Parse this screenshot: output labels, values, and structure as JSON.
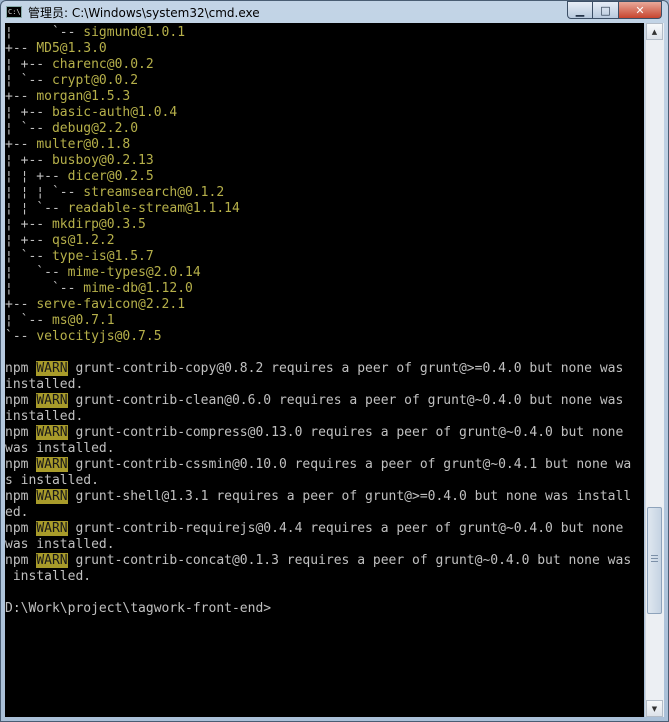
{
  "window": {
    "title": "管理员: C:\\Windows\\system32\\cmd.exe",
    "icon_text": "C:\\"
  },
  "caption": {
    "minimize": "▁",
    "maximize": "□",
    "close": "✕"
  },
  "console": {
    "lines": [
      {
        "prefix": "¦     `-- ",
        "pkg": "sigmund@1.0.1"
      },
      {
        "prefix": "+-- ",
        "pkg": "MD5@1.3.0"
      },
      {
        "prefix": "¦ +-- ",
        "pkg": "charenc@0.0.2"
      },
      {
        "prefix": "¦ `-- ",
        "pkg": "crypt@0.0.2"
      },
      {
        "prefix": "+-- ",
        "pkg": "morgan@1.5.3"
      },
      {
        "prefix": "¦ +-- ",
        "pkg": "basic-auth@1.0.4"
      },
      {
        "prefix": "¦ `-- ",
        "pkg": "debug@2.2.0"
      },
      {
        "prefix": "+-- ",
        "pkg": "multer@0.1.8"
      },
      {
        "prefix": "¦ +-- ",
        "pkg": "busboy@0.2.13"
      },
      {
        "prefix": "¦ ¦ +-- ",
        "pkg": "dicer@0.2.5"
      },
      {
        "prefix": "¦ ¦ ¦ `-- ",
        "pkg": "streamsearch@0.1.2"
      },
      {
        "prefix": "¦ ¦ `-- ",
        "pkg": "readable-stream@1.1.14"
      },
      {
        "prefix": "¦ +-- ",
        "pkg": "mkdirp@0.3.5"
      },
      {
        "prefix": "¦ +-- ",
        "pkg": "qs@1.2.2"
      },
      {
        "prefix": "¦ `-- ",
        "pkg": "type-is@1.5.7"
      },
      {
        "prefix": "¦   `-- ",
        "pkg": "mime-types@2.0.14"
      },
      {
        "prefix": "¦     `-- ",
        "pkg": "mime-db@1.12.0"
      },
      {
        "prefix": "+-- ",
        "pkg": "serve-favicon@2.2.1"
      },
      {
        "prefix": "¦ `-- ",
        "pkg": "ms@0.7.1"
      },
      {
        "prefix": "`-- ",
        "pkg": "velocityjs@0.7.5"
      },
      {
        "text": ""
      },
      {
        "npm": "npm",
        "warn": "WARN",
        "text": " grunt-contrib-copy@0.8.2 requires a peer of grunt@>=0.4.0 but none was"
      },
      {
        "text": "installed."
      },
      {
        "npm": "npm",
        "warn": "WARN",
        "text": " grunt-contrib-clean@0.6.0 requires a peer of grunt@~0.4.0 but none was"
      },
      {
        "text": "installed."
      },
      {
        "npm": "npm",
        "warn": "WARN",
        "text": " grunt-contrib-compress@0.13.0 requires a peer of grunt@~0.4.0 but none"
      },
      {
        "text": "was installed."
      },
      {
        "npm": "npm",
        "warn": "WARN",
        "text": " grunt-contrib-cssmin@0.10.0 requires a peer of grunt@~0.4.1 but none wa"
      },
      {
        "text": "s installed."
      },
      {
        "npm": "npm",
        "warn": "WARN",
        "text": " grunt-shell@1.3.1 requires a peer of grunt@>=0.4.0 but none was install"
      },
      {
        "text": "ed."
      },
      {
        "npm": "npm",
        "warn": "WARN",
        "text": " grunt-contrib-requirejs@0.4.4 requires a peer of grunt@~0.4.0 but none"
      },
      {
        "text": "was installed."
      },
      {
        "npm": "npm",
        "warn": "WARN",
        "text": " grunt-contrib-concat@0.1.3 requires a peer of grunt@~0.4.0 but none was"
      },
      {
        "text": " installed."
      },
      {
        "text": ""
      },
      {
        "text": "D:\\Work\\project\\tagwork-front-end>"
      }
    ]
  },
  "colors": {
    "background": "#000000",
    "text": "#c0c0c0",
    "package": "#b6b04a",
    "warn_bg": "#a89b2a"
  }
}
